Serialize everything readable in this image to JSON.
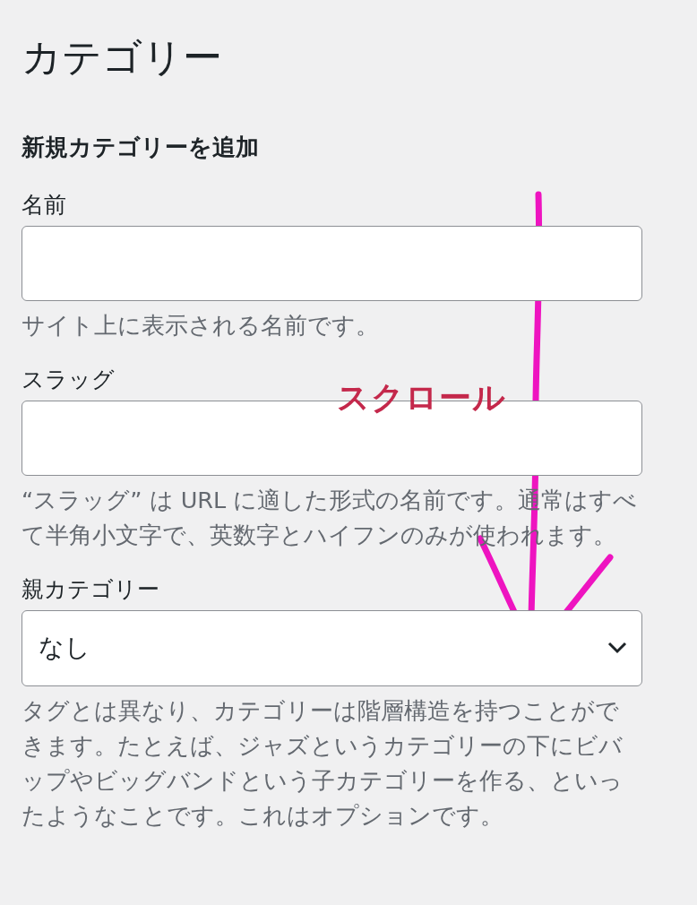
{
  "page_title": "カテゴリー",
  "section_heading": "新規カテゴリーを追加",
  "fields": [
    {
      "kind": "text",
      "label": "名前",
      "help": "サイト上に表示される名前です。"
    },
    {
      "kind": "text",
      "label": "スラッグ",
      "help": "“スラッグ” は URL に適した形式の名前です。通常はすべて半角小文字で、英数字とハイフンのみが使われます。"
    },
    {
      "kind": "select",
      "label": "親カテゴリー",
      "value": "なし",
      "help": "タグとは異なり、カテゴリーは階層構造を持つことができます。たとえば、ジャズというカテゴリーの下にビバップやビッグバンドという子カテゴリーを作る、といったようなことです。これはオプションです。"
    }
  ],
  "annotation": {
    "text": "スクロール"
  }
}
